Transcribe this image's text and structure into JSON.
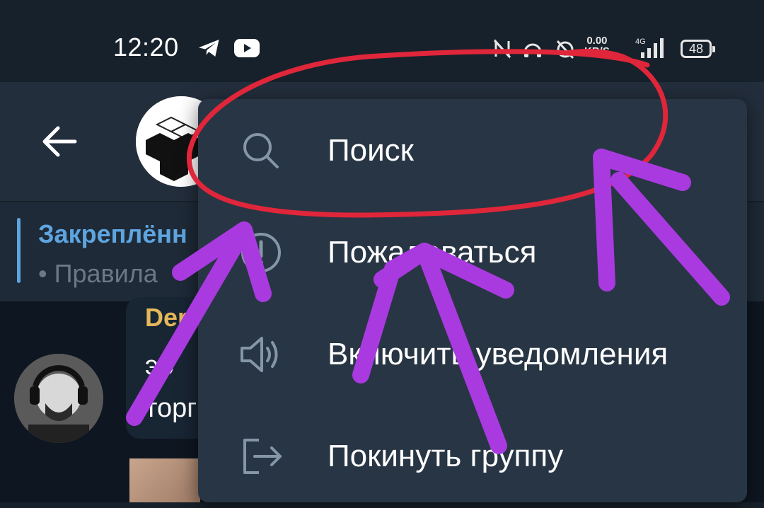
{
  "status_bar": {
    "time": "12:20",
    "icons": [
      "telegram-icon",
      "youtube-icon",
      "nfc-off-icon",
      "headset-icon",
      "alarm-off-icon",
      "net-speed-icon",
      "signal-icon"
    ],
    "net_speed_value": "0.00",
    "net_speed_unit": "KB/S",
    "battery": "48"
  },
  "header": {
    "back_icon": "arrow-left-icon",
    "avatar_icon": "group-logo"
  },
  "pinned": {
    "title": "Закреплённ",
    "text": "• Правила"
  },
  "chat": {
    "sender": "Der",
    "message_line1": "эо",
    "message_line2": "торг"
  },
  "menu": {
    "items": [
      {
        "icon": "search-icon",
        "label": "Поиск"
      },
      {
        "icon": "report-icon",
        "label": "Пожаловаться"
      },
      {
        "icon": "speaker-icon",
        "label": "Включить уведомления"
      },
      {
        "icon": "leave-icon",
        "label": "Покинуть группу"
      }
    ]
  },
  "annotations": {
    "circle_color": "#e0263a",
    "arrow_color": "#a93ae0"
  }
}
